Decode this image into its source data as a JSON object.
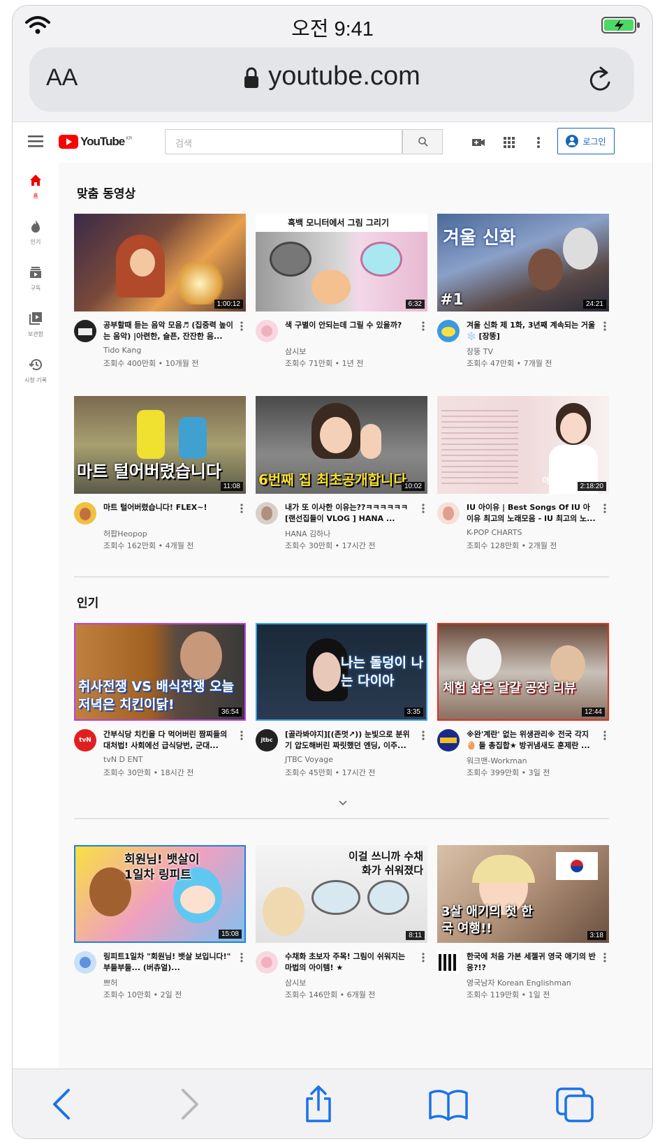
{
  "status": {
    "time": "오전 9:41"
  },
  "browser": {
    "text_size_label": "AA",
    "url": "youtube.com"
  },
  "youtube": {
    "logo": "YouTube",
    "region": "KR",
    "search_placeholder": "검색",
    "login_label": "로그인",
    "sidebar": [
      {
        "label": "홈",
        "icon": "home-icon"
      },
      {
        "label": "인기",
        "icon": "fire-icon"
      },
      {
        "label": "구독",
        "icon": "subscriptions-icon"
      },
      {
        "label": "보관함",
        "icon": "library-icon"
      },
      {
        "label": "시청 기록",
        "icon": "history-icon"
      }
    ],
    "sections": [
      {
        "title": "맞춤 동영상",
        "videos": [
          {
            "title": "공부할때 듣는 음악 모음♬ (집중력 높이는 음악) |아련한, 슬픈, 잔잔한 음...",
            "channel": "Tido Kang",
            "stats": "조회수 400만회 • 10개월 전",
            "duration": "1:00:12",
            "overlay": ""
          },
          {
            "title": "색 구별이 안되는데 그릴 수 있을까?",
            "channel": "삼시보",
            "stats": "조회수 71만회 • 1년 전",
            "duration": "6:32",
            "overlay": "흑백 모니터에서 그림 그리기"
          },
          {
            "title": "겨울 신화 제 1화, 3년째 계속되는 거울 ❄️ [장뚱]",
            "channel": "장뚱 TV",
            "stats": "조회수 47만회 • 7개월 전",
            "duration": "24:21",
            "overlay": "겨울 신화"
          },
          {
            "title": "마트 털어버렸습니다! FLEX~!",
            "channel": "허팝Heopop",
            "stats": "조회수 162만회 • 4개월 전",
            "duration": "11:08",
            "overlay": "마트 털어버렸습니다"
          },
          {
            "title": "내가 또 이사한 이유는??ㅋㅋㅋㅋㅋㅋ [랜선집들이 VLOG ] HANA ...",
            "channel": "HANA 김하나",
            "stats": "조회수 30만회 • 17시간 전",
            "duration": "10:02",
            "overlay": "6번째 집 최초공개합니다"
          },
          {
            "title": "IU 아이유 | Best Songs Of IU 아이유 최고의 노래모음 - IU 최고의 노...",
            "channel": "K-POP CHARTS",
            "stats": "조회수 128만회 • 2개월 전",
            "duration": "2:18:20",
            "overlay": "아이유"
          }
        ]
      },
      {
        "title": "인기",
        "videos": [
          {
            "title": "간부식당 치킨을 다 먹어버린 짬찌들의 대처법! 사회에선 급식당번, 군대...",
            "channel": "tvN D ENT",
            "stats": "조회수 30만회 • 18시간 전",
            "duration": "36:54",
            "overlay": "취사전쟁 VS 배식전쟁 오늘 저녁은 치킨이닭!"
          },
          {
            "title": "[골라봐야지][(존멋↗)) 눈빛으로 분위기 압도해버린 짜릿했던 엔딩, 이주...",
            "channel": "JTBC Voyage",
            "stats": "조회수 45만회 • 17시간 전",
            "duration": "3:35",
            "overlay": "나는 돌덩이 나는 다이아"
          },
          {
            "title": "※완'계란' 없는 위생관리※ 전국 각지🥚 들 총집합★ 방귀냄새도 훈제란 ...",
            "channel": "워크맨-Workman",
            "stats": "조회수 399만회 • 3일 전",
            "duration": "12:44",
            "overlay": "체험 삶은 달걀 공장 리뷰"
          }
        ]
      },
      {
        "title": "",
        "videos": [
          {
            "title": "링피트1일차 \"회원님! 뱃살 보입니다!\" 부들부들... (버츄얼)...",
            "channel": "쁘허",
            "stats": "조회수 10만회 • 2일 전",
            "duration": "15:08",
            "overlay": "회원님! 뱃살이 1일차 링피트"
          },
          {
            "title": "수채화 초보자 주목! 그림이 쉬워지는 마법의 아이템! ★",
            "channel": "삼시보",
            "stats": "조회수 146만회 • 6개월 전",
            "duration": "8:11",
            "overlay": "이걸 쓰니까 수채화가 쉬워졌다"
          },
          {
            "title": "한국에 처음 가본 세젤귀 영국 애기의 반응?!?",
            "channel": "영국남자 Korean Englishman",
            "stats": "조회수 119만회 • 1일 전",
            "duration": "3:18",
            "overlay": "3살 애기의 첫 한국 여행!!"
          }
        ]
      }
    ]
  },
  "colors": {
    "youtube_red": "#ff0000",
    "link_blue": "#1565c0",
    "ios_blue": "#1a73e8"
  }
}
